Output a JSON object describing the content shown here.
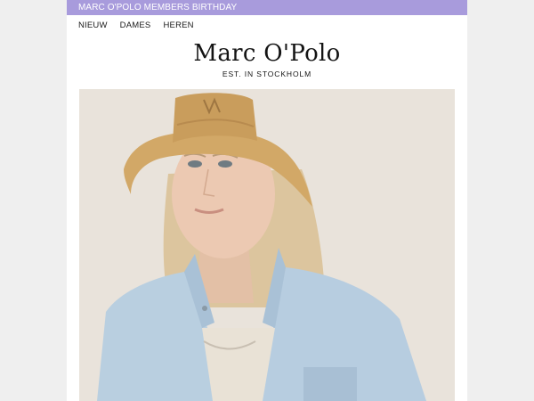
{
  "promo": {
    "text": "MARC O'POLO MEMBERS BIRTHDAY"
  },
  "nav": {
    "items": [
      "NIEUW",
      "DAMES",
      "HEREN"
    ]
  },
  "brand": {
    "logo": "Marc O'Polo",
    "tagline": "EST. IN STOCKHOLM"
  },
  "hero": {
    "image_icon": "woman-in-straw-hat-and-denim-jacket-photo"
  },
  "colors": {
    "promo_bg": "#a89bdc",
    "page_bg": "#efefef",
    "hero_bg": "#ece5de"
  }
}
